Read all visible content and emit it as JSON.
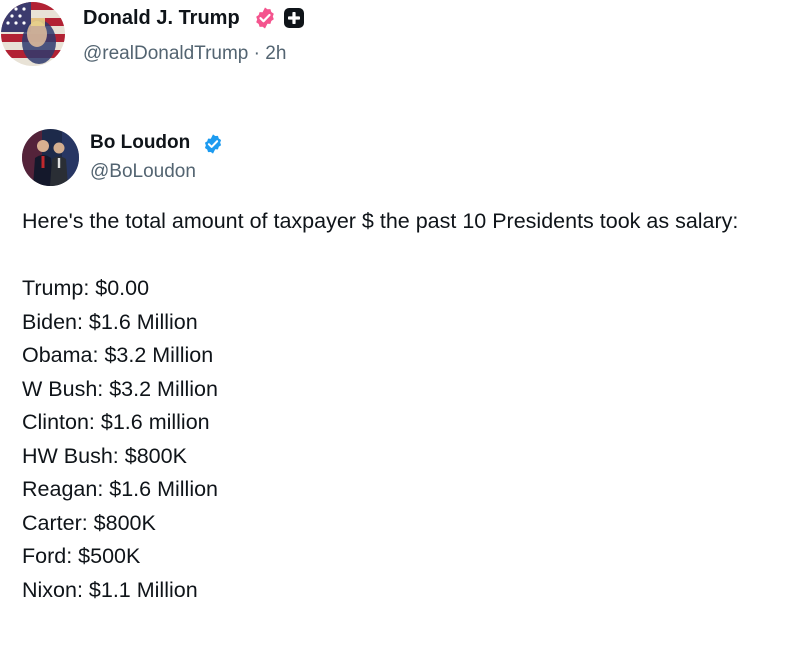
{
  "post": {
    "author_name": "Donald J. Trump",
    "author_handle": "@realDonaldTrump",
    "separator": "·",
    "time": "2h",
    "verified_badge_color": "#f4548e",
    "plus_badge_color": "#0f1419",
    "avatar_icon": "flag-portrait-avatar"
  },
  "quoted": {
    "author_name": "Bo Loudon",
    "author_handle": "@BoLoudon",
    "verified_badge_color": "#1d9bf0",
    "avatar_icon": "two-people-portrait-avatar",
    "intro": "Here's the total amount of taxpayer $ the past 10 Presidents took as salary:",
    "salaries": [
      "Trump: $0.00",
      "Biden: $1.6 Million",
      "Obama: $3.2 Million",
      "W Bush: $3.2 Million",
      "Clinton: $1.6 million",
      "HW Bush: $800K",
      "Reagan: $1.6 Million",
      "Carter: $800K",
      "Ford: $500K",
      "Nixon: $1.1 Million"
    ]
  },
  "colors": {
    "text_primary": "#0f1419",
    "text_secondary": "#536471",
    "background": "#ffffff"
  }
}
